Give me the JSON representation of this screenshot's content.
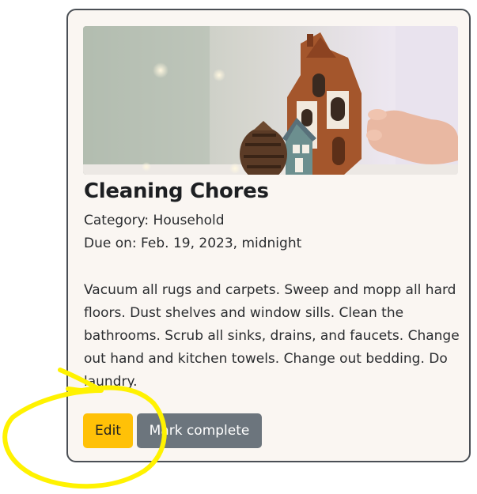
{
  "card": {
    "title": "Cleaning Chores",
    "category": "Category: Household",
    "due": "Due on: Feb. 19, 2023, midnight",
    "description": "Vacuum all rugs and carpets. Sweep and mopp all hard floors. Dust shelves and window sills. Clean the bathrooms. Scrub all sinks, drains, and faucets. Change out hand and kitchen towels. Change out bedding. Do laundry.",
    "image_subject": "ceramic house figurine with pinecone by window"
  },
  "actions": {
    "edit_label": "Edit",
    "complete_label": "Mark complete"
  },
  "colors": {
    "edit_button": "#ffc107",
    "complete_button": "#6c757d",
    "card_background": "#faf6f2",
    "card_border": "#4a4f55",
    "annotation_highlight": "#fff200"
  }
}
